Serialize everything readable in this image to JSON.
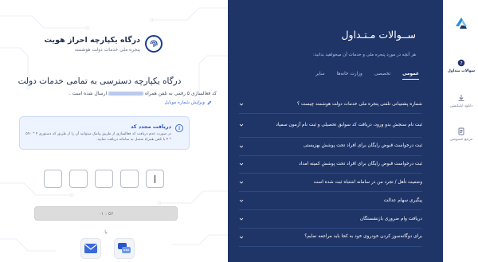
{
  "login": {
    "brand_title": "درگاه یکپارچه احراز هویت",
    "brand_subtitle": "پنجره ملی خدمات دولت هوشمند",
    "heading": "درگاه یکپارچه دسترسی به تمامی خدمات دولت",
    "sms_note_prefix": "کد فعالسازی ۵ رقمی به تلفن همراه",
    "sms_note_suffix": "ارسال شده است .",
    "edit_phone_label": "ویرایش شماره موبایل",
    "resend": {
      "title": "دریافت مجدد کد",
      "body": "در صورت عدم دریافت کد فعالسازی از طریق پیامک میتوانید آن را از طریق کد دستوری ۴ * ۵۹۰ * ۴ با تلفن همراه متصل به سامانه دریافت نمایید."
    },
    "code_digits": [
      "",
      "",
      "",
      "",
      ""
    ],
    "timer_text": "۰۱ : ۵۶",
    "or_label": "یا"
  },
  "faq": {
    "title": "ســوالات مـتـداول",
    "description": "هر آنچه در مورد پنجره ملی و خدمات آن میخواهید بدانید:",
    "tabs": [
      {
        "label": "عمومی",
        "active": true
      },
      {
        "label": "تخصصی",
        "active": false
      },
      {
        "label": "وزارت خانه‌ها",
        "active": false
      },
      {
        "label": "سایر",
        "active": false
      }
    ],
    "questions": [
      "شماره پشتیبانی تلفنی پنجره ملی خدمات دولت هوشمند چیست ؟",
      "ثبت نام سنجش بدو ورود، دریافت کد سوابق تحصیلی و ثبت نام آزمون سمپاد",
      "ثبت درخواست قبوض رایگان برای افراد تحت پوشش بهزیستی",
      "ثبت درخواست قبوض رایگان برای افراد تحت پوشش کمیته امداد",
      "وضعیت تأهل / تجرد من در سامانه اشتباه ثبت شده است",
      "پیگیری سهام عدالت",
      "دریافت وام ضروری بازنشستگان",
      "برای دوگانه‌سوز کردن خودروی خود به کجا باید مراجعه نمایم؟"
    ]
  },
  "sidenav": {
    "items": [
      {
        "label": "سوالات متداول",
        "icon": "question-icon",
        "active": true
      },
      {
        "label": "دانلود اپلیکیشن",
        "icon": "download-icon",
        "active": false
      },
      {
        "label": "مرجع خصوصی",
        "icon": "document-icon",
        "active": false
      }
    ]
  },
  "colors": {
    "faq_background": "#1f3568",
    "accent": "#3a6ad9",
    "resend_background": "#eef4ff"
  }
}
